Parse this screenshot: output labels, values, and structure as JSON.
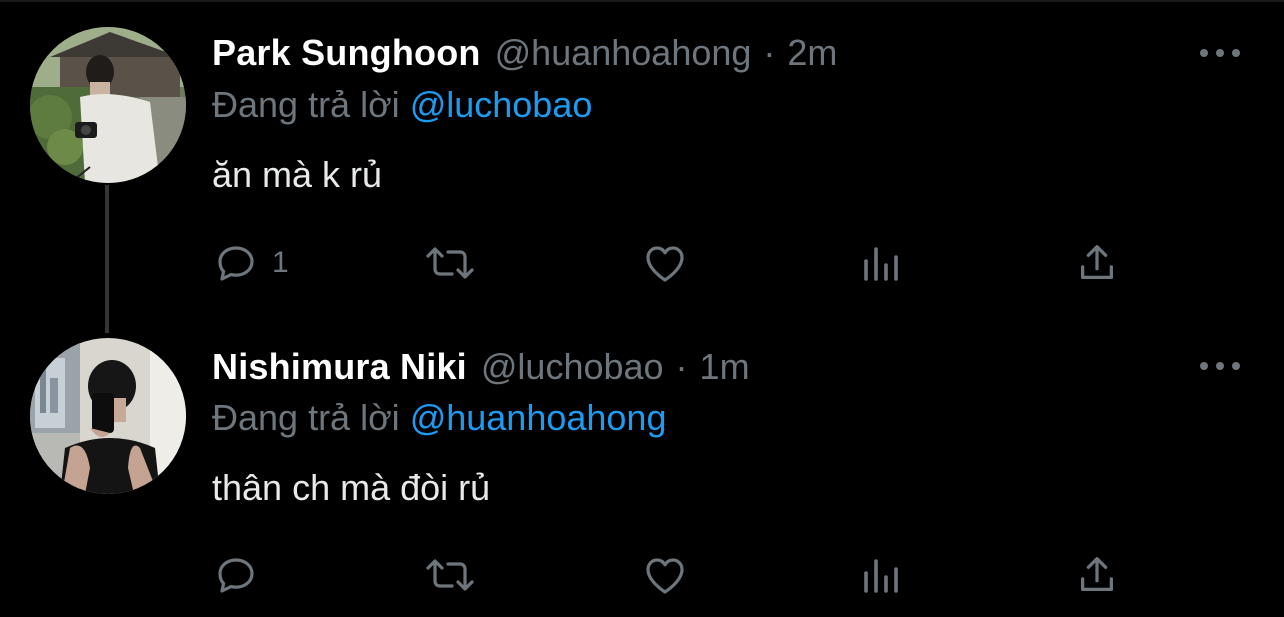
{
  "tweets": [
    {
      "display_name": "Park Sunghoon",
      "handle": "@huanhoahong",
      "separator": "·",
      "time": "2m",
      "reply_prefix": "Đang trả lời",
      "reply_to": "@luchobao",
      "text": "ăn mà k rủ",
      "reply_count": "1",
      "avatar": "avatar-photo-man-with-camera"
    },
    {
      "display_name": "Nishimura Niki",
      "handle": "@luchobao",
      "separator": "·",
      "time": "1m",
      "reply_prefix": "Đang trả lời",
      "reply_to": "@huanhoahong",
      "text": "thân ch mà đòi rủ",
      "reply_count": "",
      "avatar": "avatar-photo-mirror-selfie"
    }
  ],
  "icons": {
    "reply": "reply-icon",
    "retweet": "retweet-icon",
    "like": "heart-icon",
    "analytics": "analytics-icon",
    "share": "share-icon",
    "more": "more-icon"
  },
  "colors": {
    "background": "#000000",
    "text_primary": "#ffffff",
    "text_secondary": "#6e767d",
    "mention": "#1d9bf0",
    "thread_line": "#333639"
  }
}
